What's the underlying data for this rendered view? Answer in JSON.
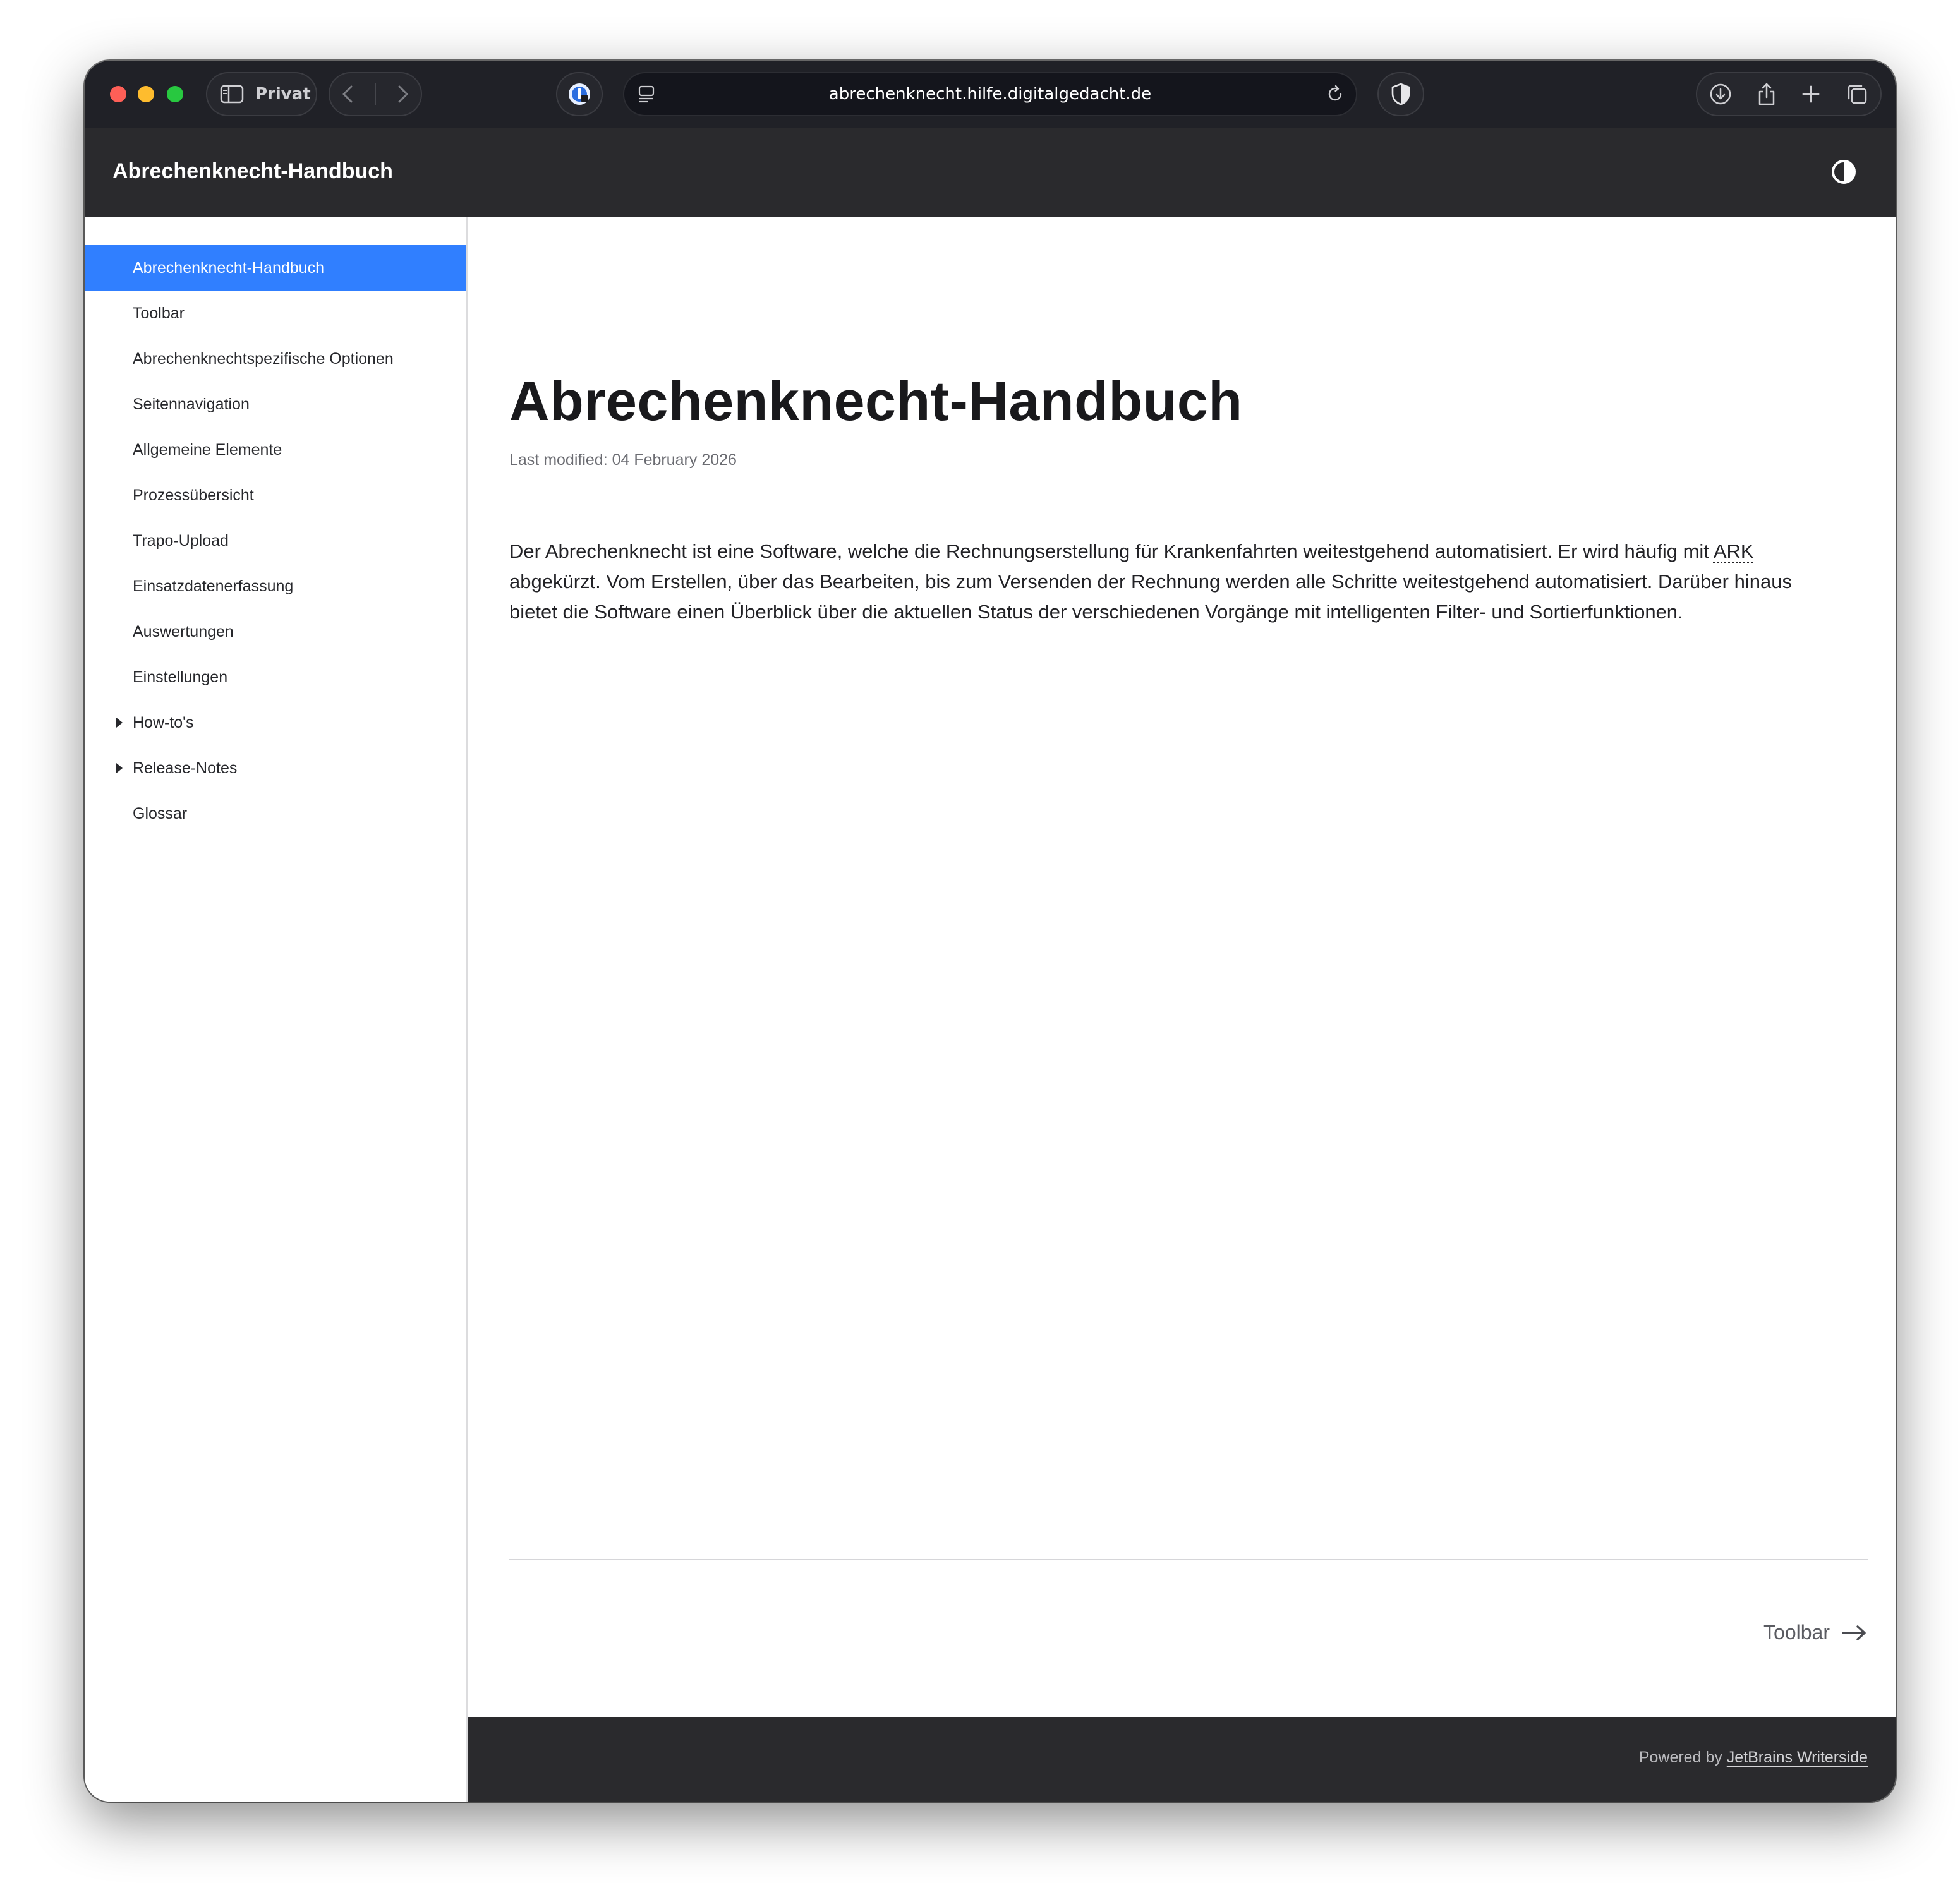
{
  "browser": {
    "private_label": "Privat",
    "url": "abrechenknecht.hilfe.digitalgedacht.de"
  },
  "header": {
    "title": "Abrechenknecht-Handbuch"
  },
  "sidebar": {
    "items": [
      {
        "label": "Abrechenknecht-Handbuch",
        "active": true
      },
      {
        "label": "Toolbar"
      },
      {
        "label": "Abrechenknechtspezifische Optionen"
      },
      {
        "label": "Seitennavigation"
      },
      {
        "label": "Allgemeine Elemente"
      },
      {
        "label": "Prozessübersicht"
      },
      {
        "label": "Trapo-Upload"
      },
      {
        "label": "Einsatzdatenerfassung"
      },
      {
        "label": "Auswertungen"
      },
      {
        "label": "Einstellungen"
      },
      {
        "label": "How-to's",
        "expandable": true
      },
      {
        "label": "Release-Notes",
        "expandable": true
      },
      {
        "label": "Glossar"
      }
    ]
  },
  "main": {
    "title": "Abrechenknecht-Handbuch",
    "last_modified": "Last modified: 04 February 2026",
    "intro_part1": "Der Abrechenknecht ist eine Software, welche die Rechnungserstellung für Krankenfahrten weitestgehend automatisiert. Er wird häufig mit ",
    "intro_abbr": "ARK",
    "intro_part2": " abgekürzt. Vom Erstellen, über das Bearbeiten, bis zum Versenden der Rechnung werden alle Schritte weitestgehend automatisiert. Darüber hinaus bietet die Software einen Überblick über die aktuellen Status der verschiedenen Vorgänge mit intelligenten Filter- und Sortierfunktionen.",
    "next_label": "Toolbar"
  },
  "footer": {
    "powered_prefix": "Powered by ",
    "powered_link": "JetBrains Writerside"
  },
  "colors": {
    "accent": "#307fff",
    "header_bg": "#2a2a2d",
    "chrome_bg": "#202127"
  }
}
